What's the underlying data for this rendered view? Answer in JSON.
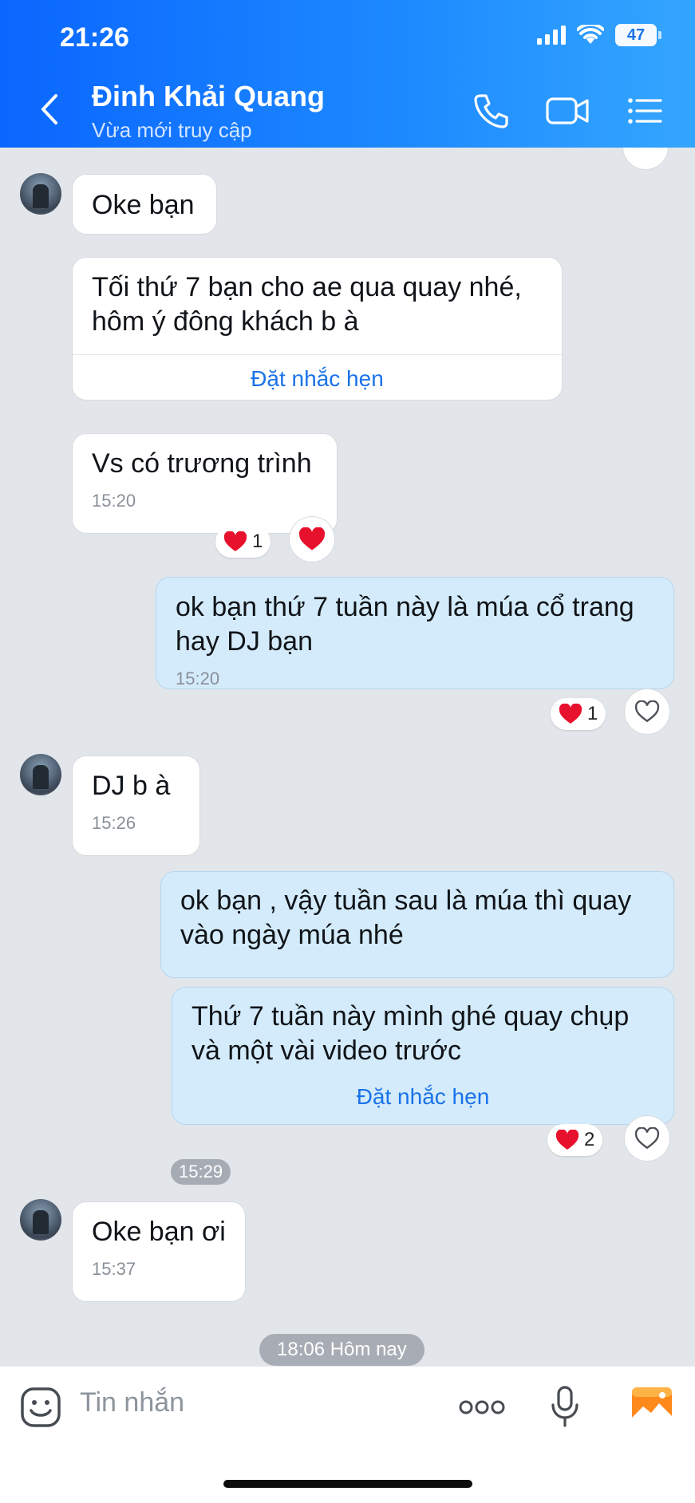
{
  "status_bar": {
    "time": "21:26",
    "battery": "47"
  },
  "header": {
    "contact_name": "Đinh Khải Quang",
    "contact_status": "Vừa mới truy cập"
  },
  "messages": [
    {
      "sender": "them",
      "text": "Oke bạn"
    },
    {
      "sender": "them",
      "text": "Tối thứ 7 bạn cho ae qua quay nhé,\nhôm ý đông khách b à",
      "action": "Đặt nhắc hẹn"
    },
    {
      "sender": "them",
      "text": "Vs có trương trình",
      "time": "15:20",
      "reaction_count": "1"
    },
    {
      "sender": "me",
      "text": "ok bạn thứ 7 tuần này là múa cổ trang\nhay DJ bạn",
      "time": "15:20",
      "reaction_count": "1"
    },
    {
      "sender": "them",
      "text": "DJ b à",
      "time": "15:26"
    },
    {
      "sender": "me",
      "text": "ok bạn , vậy tuần sau là múa thì quay\nvào ngày múa nhé"
    },
    {
      "sender": "me",
      "text": "Thứ 7 tuần này mình ghé quay chụp\nvà một vài video trước",
      "action": "Đặt nhắc hẹn",
      "reaction_count": "2"
    },
    {
      "sender": "them",
      "text": "Oke bạn ơi",
      "time": "15:37"
    }
  ],
  "separators": {
    "group_time": "15:29",
    "day": "18:06 Hôm nay"
  },
  "composer": {
    "placeholder": "Tin nhắn"
  },
  "icons": [
    "back-icon",
    "phone-icon",
    "video-call-icon",
    "menu-icon",
    "sticker-icon",
    "more-icon",
    "mic-icon",
    "image-icon",
    "heart-icon"
  ],
  "colors": {
    "header_start": "#0a66ff",
    "header_end": "#35a6ff",
    "my_bubble": "#d4ebfb",
    "link": "#1a73e8",
    "heart": "#e8112d"
  }
}
